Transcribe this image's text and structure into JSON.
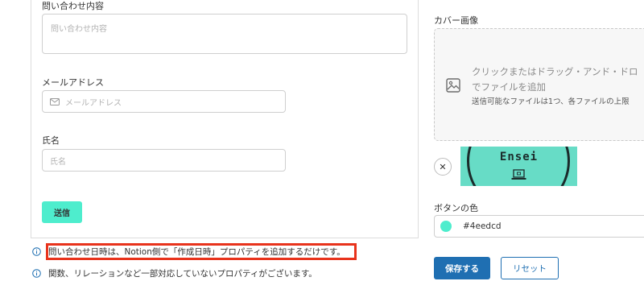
{
  "form": {
    "inquiry_label": "問い合わせ内容",
    "inquiry_placeholder": "問い合わせ内容",
    "email_label": "メールアドレス",
    "email_placeholder": "メールアドレス",
    "name_label": "氏名",
    "name_placeholder": "氏名",
    "submit_label": "送信"
  },
  "notes": [
    "問い合わせ日時は、Notion側で「作成日時」プロパティを追加するだけです。",
    "関数、リレーションなど一部対応していないプロパティがございます。"
  ],
  "settings": {
    "cover_label": "カバー画像",
    "dropzone_line1": "クリックまたはドラッグ・アンド・ドロ",
    "dropzone_line2": "でファイルを追加",
    "dropzone_note": "送信可能なファイルは1つ、各ファイルの上限",
    "remove_symbol": "✕",
    "cover_image_text": "Ensei",
    "button_color_label": "ボタンの色",
    "button_color_value": "#4eedcd",
    "save_label": "保存する",
    "reset_label": "リセット"
  },
  "colors": {
    "accent": "#4eedcd",
    "primary_blue": "#1f6fb2",
    "highlight_red": "#e8331c"
  },
  "icons": [
    "mail-icon",
    "info-icon",
    "image-icon",
    "close-icon",
    "laptop-icon"
  ]
}
